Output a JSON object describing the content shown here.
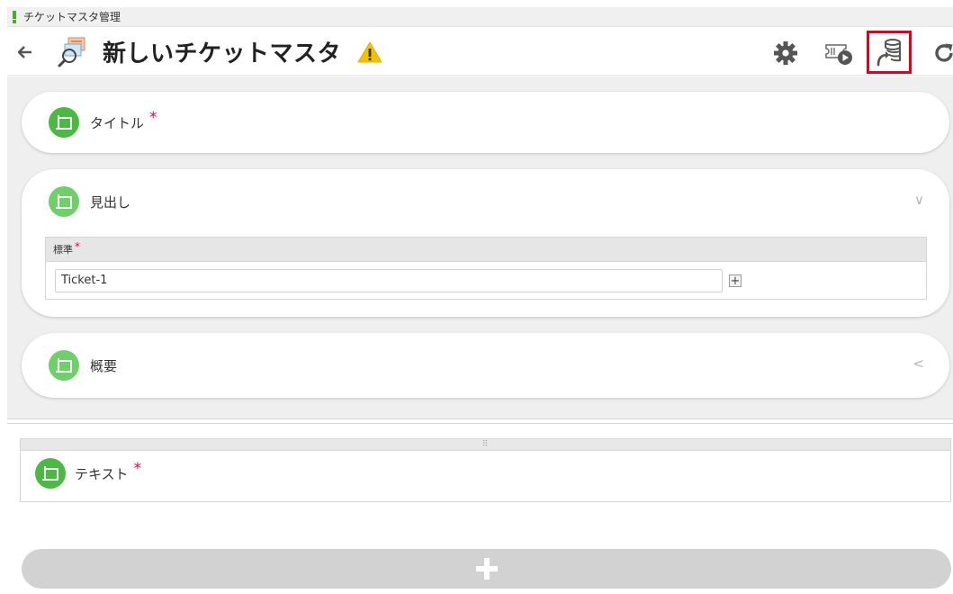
{
  "window": {
    "title": "チケットマスタ管理"
  },
  "header": {
    "title": "新しいチケットマスタ"
  },
  "icons": {
    "back": "arrow-left-icon",
    "app": "ticket-master-icon",
    "warning": "warning-icon",
    "settings": "gear-icon",
    "run": "run-ticket-icon",
    "deploy": "deploy-icon",
    "refresh": "refresh-icon",
    "section": "section-frame-icon",
    "add": "plus-icon"
  },
  "colors": {
    "accent": "#4cb944",
    "required": "#e5004f",
    "highlight": "#e3001b",
    "warning": "#f2c200"
  },
  "sections": [
    {
      "label": "タイトル",
      "required": "*"
    },
    {
      "label": "見出し",
      "chevron": "∨",
      "field": {
        "header": "標準",
        "required": "*",
        "value": "Ticket-1",
        "add": "+"
      }
    },
    {
      "label": "概要",
      "chevron": "<"
    }
  ],
  "lower": {
    "handle": "⠿",
    "text_label": "テキスト",
    "required": "*",
    "add_label": "+"
  }
}
